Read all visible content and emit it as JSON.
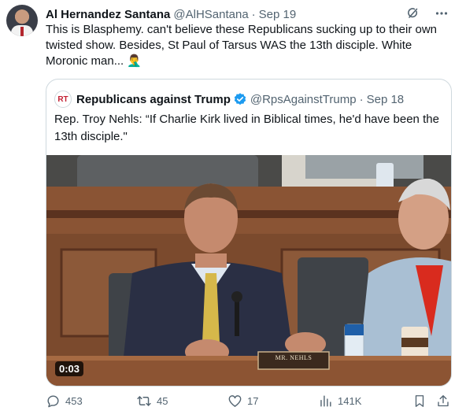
{
  "tweet": {
    "author_name": "Al Hernandez Santana",
    "handle": "@AlHSantana",
    "separator": "·",
    "date": "Sep 19",
    "text": "This is Blasphemy. can't believe these Republicans sucking up to their own twisted show. Besides, St Paul of Tarsus WAS the 13th disciple. White Moronic man... 🤦‍♂️",
    "header_icons": [
      "grok-icon",
      "more-icon"
    ]
  },
  "quoted": {
    "author_name": "Republicans against Trump",
    "avatar_text": "RT",
    "verified": true,
    "handle": "@RpsAgainstTrump",
    "separator": "·",
    "date": "Sep 18",
    "text": "Rep. Troy Nehls: “If Charlie Kirk lived in Biblical times, he'd have been the 13th disciple.\"",
    "video": {
      "duration": "0:03",
      "nameplate": "MR. NEHLS"
    }
  },
  "actions": {
    "replies": "453",
    "retweets": "45",
    "likes": "17",
    "views": "141K",
    "icons": [
      "reply-icon",
      "retweet-icon",
      "like-icon",
      "views-icon",
      "bookmark-icon",
      "share-icon"
    ]
  },
  "colors": {
    "text": "#0f1419",
    "secondary": "#536471",
    "border": "#cfd9de",
    "verified": "#1d9bf0"
  }
}
